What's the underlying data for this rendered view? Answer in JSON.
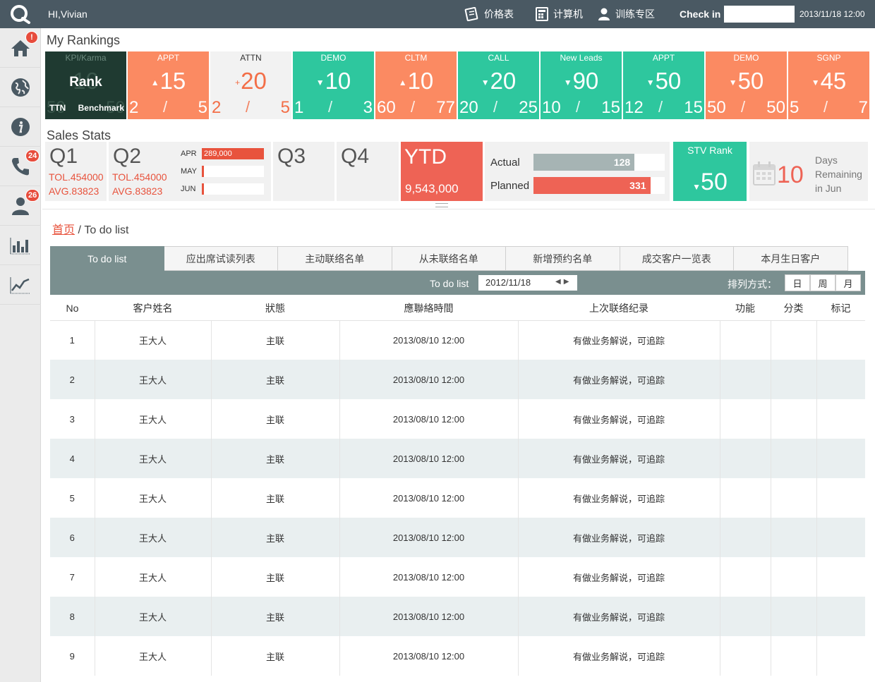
{
  "header": {
    "greeting": "HI,Vivian",
    "links": [
      {
        "label": "价格表",
        "icon": "price-list-icon"
      },
      {
        "label": "计算机",
        "icon": "calculator-icon"
      },
      {
        "label": "训练专区",
        "icon": "user-training-icon"
      }
    ],
    "checkin_label": "Check in",
    "checkin_value": "",
    "datetime": "2013/11/18 12:00"
  },
  "sidebar": {
    "items": [
      {
        "icon": "home-icon",
        "badge": "!"
      },
      {
        "icon": "globe-icon",
        "badge": ""
      },
      {
        "icon": "info-icon",
        "badge": ""
      },
      {
        "icon": "phone-icon",
        "badge": "24"
      },
      {
        "icon": "person-icon",
        "badge": "26"
      },
      {
        "icon": "bar-chart-icon",
        "badge": ""
      },
      {
        "icon": "line-chart-icon",
        "badge": ""
      }
    ]
  },
  "rankings": {
    "title": "My Rankings",
    "rank_tile": {
      "top": "KPI/Karma",
      "main": "Rank",
      "left": "TTN",
      "right": "Benchmark",
      "ghost_big": "10",
      "ghost_left": "50",
      "ghost_right": "50"
    },
    "tiles": [
      {
        "label": "APPT",
        "value": "15",
        "trend": "up",
        "left": "2",
        "right": "5",
        "color": "orange"
      },
      {
        "label": "ATTN",
        "value": "20",
        "trend": "plus",
        "left": "2",
        "right": "5",
        "color": "light"
      },
      {
        "label": "DEMO",
        "value": "10",
        "trend": "down",
        "left": "1",
        "right": "3",
        "color": "green"
      },
      {
        "label": "CLTM",
        "value": "10",
        "trend": "up",
        "left": "60",
        "right": "77",
        "color": "orange"
      },
      {
        "label": "CALL",
        "value": "20",
        "trend": "down",
        "left": "20",
        "right": "25",
        "color": "green"
      },
      {
        "label": "New Leads",
        "value": "90",
        "trend": "down",
        "left": "10",
        "right": "15",
        "color": "green"
      },
      {
        "label": "APPT",
        "value": "50",
        "trend": "down",
        "left": "12",
        "right": "15",
        "color": "green"
      },
      {
        "label": "DEMO",
        "value": "50",
        "trend": "down",
        "left": "50",
        "right": "50",
        "color": "orange"
      },
      {
        "label": "SGNP",
        "value": "45",
        "trend": "down",
        "left": "5",
        "right": "7",
        "color": "orange"
      }
    ],
    "slash": "/"
  },
  "sales": {
    "title": "Sales Stats",
    "q1": {
      "label": "Q1",
      "tol": "TOL.454000",
      "avg": "AVG.83823"
    },
    "q2": {
      "label": "Q2",
      "tol": "TOL.454000",
      "avg": "AVG.83823"
    },
    "months": [
      {
        "label": "APR",
        "value": "289,000",
        "fill": 1.0
      },
      {
        "label": "MAY",
        "value": "",
        "fill": 0
      },
      {
        "label": "JUN",
        "value": "",
        "fill": 0
      }
    ],
    "q3": "Q3",
    "q4": "Q4",
    "ytd": {
      "label": "YTD",
      "value": "9,543,000"
    },
    "actual": {
      "label": "Actual",
      "value": "128",
      "fill": 0.77,
      "color": "#a6b4b4"
    },
    "planned": {
      "label": "Planned",
      "value": "331",
      "fill": 0.89,
      "color": "#ee6355"
    },
    "stv": {
      "label": "STV Rank",
      "value": "50"
    },
    "days": {
      "value": "10",
      "line1": "Days",
      "line2": "Remaining",
      "line3": "in Jun"
    }
  },
  "breadcrumb": {
    "home": "首页",
    "sep": " / ",
    "current": "To do list"
  },
  "tabs": [
    "To do list",
    "应出席试读列表",
    "主动联络名单",
    "从未联络名单",
    "新增预约名单",
    "成交客户一览表",
    "本月生日客户"
  ],
  "toolbar": {
    "title": "To do list",
    "date": "2012/11/18",
    "sort_label": "排列方式：",
    "sort_options": [
      "日",
      "周",
      "月"
    ]
  },
  "table": {
    "headers": [
      "No",
      "客户姓名",
      "狀態",
      "應聯絡時間",
      "上次联络纪录",
      "功能",
      "分类",
      "标记"
    ],
    "rows": [
      [
        "1",
        "王大人",
        "主联",
        "2013/08/10 12:00",
        "有做业务解说，可追踪",
        "",
        "",
        ""
      ],
      [
        "2",
        "王大人",
        "主联",
        "2013/08/10 12:00",
        "有做业务解说，可追踪",
        "",
        "",
        ""
      ],
      [
        "3",
        "王大人",
        "主联",
        "2013/08/10 12:00",
        "有做业务解说，可追踪",
        "",
        "",
        ""
      ],
      [
        "4",
        "王大人",
        "主联",
        "2013/08/10 12:00",
        "有做业务解说，可追踪",
        "",
        "",
        ""
      ],
      [
        "5",
        "王大人",
        "主联",
        "2013/08/10 12:00",
        "有做业务解说，可追踪",
        "",
        "",
        ""
      ],
      [
        "6",
        "王大人",
        "主联",
        "2013/08/10 12:00",
        "有做业务解说，可追踪",
        "",
        "",
        ""
      ],
      [
        "7",
        "王大人",
        "主联",
        "2013/08/10 12:00",
        "有做业务解说，可追踪",
        "",
        "",
        ""
      ],
      [
        "8",
        "王大人",
        "主联",
        "2013/08/10 12:00",
        "有做业务解说，可追踪",
        "",
        "",
        ""
      ],
      [
        "9",
        "王大人",
        "主联",
        "2013/08/10 12:00",
        "有做业务解说，可追踪",
        "",
        "",
        ""
      ]
    ]
  }
}
